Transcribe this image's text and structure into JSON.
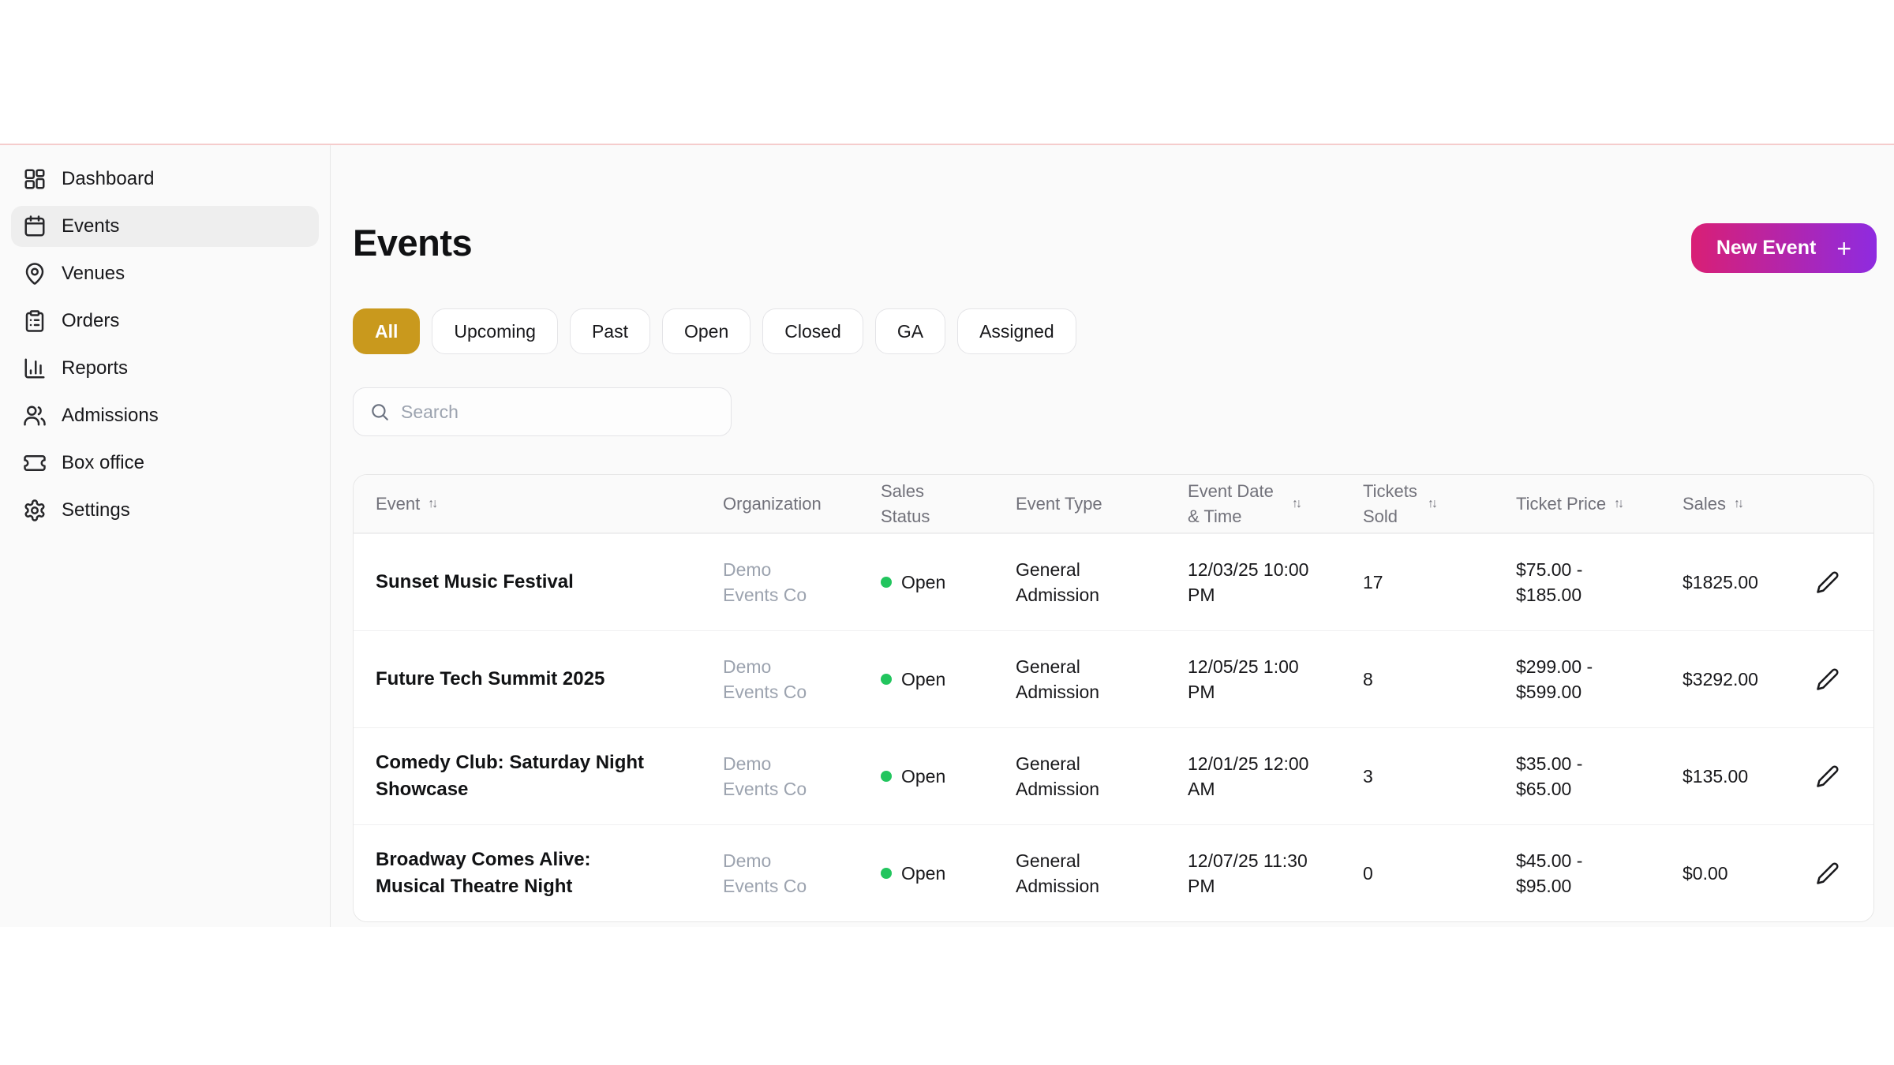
{
  "sidebar": {
    "items": [
      {
        "label": "Dashboard",
        "icon": "dashboard-icon",
        "active": false
      },
      {
        "label": "Events",
        "icon": "calendar-icon",
        "active": true
      },
      {
        "label": "Venues",
        "icon": "map-pin-icon",
        "active": false
      },
      {
        "label": "Orders",
        "icon": "clipboard-icon",
        "active": false
      },
      {
        "label": "Reports",
        "icon": "bar-chart-icon",
        "active": false
      },
      {
        "label": "Admissions",
        "icon": "users-icon",
        "active": false
      },
      {
        "label": "Box office",
        "icon": "ticket-icon",
        "active": false
      },
      {
        "label": "Settings",
        "icon": "gear-icon",
        "active": false
      }
    ]
  },
  "header": {
    "title": "Events",
    "new_event_label": "New Event",
    "plus": "+"
  },
  "filters": {
    "items": [
      {
        "label": "All",
        "active": true
      },
      {
        "label": "Upcoming",
        "active": false
      },
      {
        "label": "Past",
        "active": false
      },
      {
        "label": "Open",
        "active": false
      },
      {
        "label": "Closed",
        "active": false
      },
      {
        "label": "GA",
        "active": false
      },
      {
        "label": "Assigned",
        "active": false
      }
    ]
  },
  "search": {
    "placeholder": "Search",
    "value": ""
  },
  "table": {
    "sort_glyph": "↑↓",
    "columns": [
      {
        "label": "Event",
        "sortable": true
      },
      {
        "label": "Organization",
        "sortable": false
      },
      {
        "label": "Sales Status",
        "sortable": false
      },
      {
        "label": "Event Type",
        "sortable": false
      },
      {
        "label": "Event Date & Time",
        "sortable": true
      },
      {
        "label": "Tickets Sold",
        "sortable": true
      },
      {
        "label": "Ticket Price",
        "sortable": true
      },
      {
        "label": "Sales",
        "sortable": true
      }
    ],
    "rows": [
      {
        "event": "Sunset Music Festival",
        "organization": "Demo Events Co",
        "sales_status": "Open",
        "event_type": "General Admission",
        "datetime": "12/03/25 10:00 PM",
        "tickets_sold": "17",
        "ticket_price": "$75.00 - $185.00",
        "sales": "$1825.00"
      },
      {
        "event": "Future Tech Summit 2025",
        "organization": "Demo Events Co",
        "sales_status": "Open",
        "event_type": "General Admission",
        "datetime": "12/05/25 1:00 PM",
        "tickets_sold": "8",
        "ticket_price": "$299.00 - $599.00",
        "sales": "$3292.00"
      },
      {
        "event": "Comedy Club: Saturday Night Showcase",
        "organization": "Demo Events Co",
        "sales_status": "Open",
        "event_type": "General Admission",
        "datetime": "12/01/25 12:00 AM",
        "tickets_sold": "3",
        "ticket_price": "$35.00 - $65.00",
        "sales": "$135.00"
      },
      {
        "event": "Broadway Comes Alive: Musical Theatre Night",
        "organization": "Demo Events Co",
        "sales_status": "Open",
        "event_type": "General Admission",
        "datetime": "12/07/25 11:30 PM",
        "tickets_sold": "0",
        "ticket_price": "$45.00 - $95.00",
        "sales": "$0.00"
      }
    ]
  },
  "colors": {
    "accent_gold": "#c9991d",
    "button_gradient_start": "#d91f75",
    "button_gradient_end": "#8e2be0",
    "status_open_green": "#22c55e",
    "topbar_line_pink": "#f5cccc",
    "app_background": "#fafafa"
  }
}
